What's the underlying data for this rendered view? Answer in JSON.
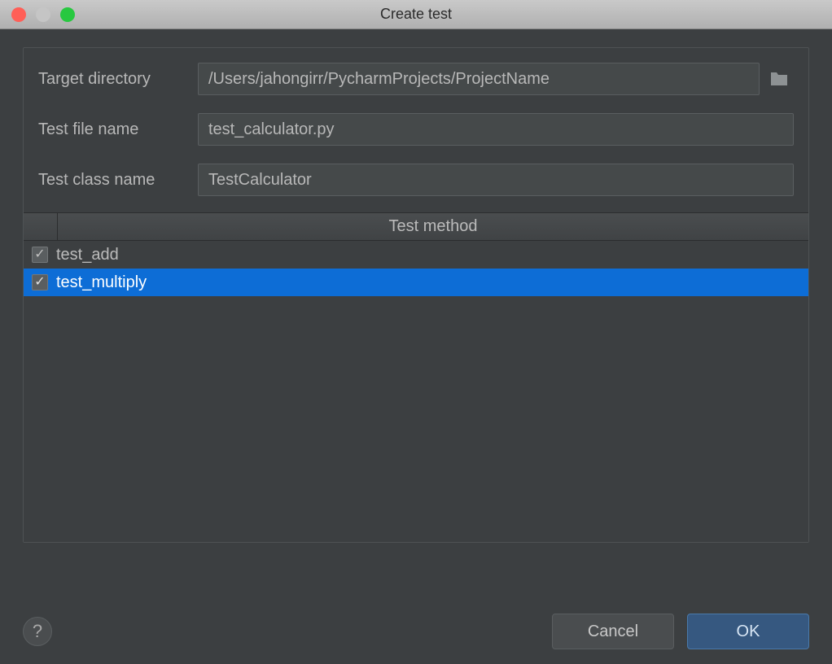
{
  "window": {
    "title": "Create test"
  },
  "form": {
    "target_directory_label": "Target directory",
    "target_directory_value": "/Users/jahongirr/PycharmProjects/ProjectName",
    "test_file_name_label": "Test file name",
    "test_file_name_value": "test_calculator.py",
    "test_class_name_label": "Test class name",
    "test_class_name_value": "TestCalculator"
  },
  "methods_table": {
    "header": "Test method",
    "rows": [
      {
        "label": "test_add",
        "checked": true,
        "selected": false
      },
      {
        "label": "test_multiply",
        "checked": true,
        "selected": true
      }
    ]
  },
  "buttons": {
    "help": "?",
    "cancel": "Cancel",
    "ok": "OK"
  }
}
